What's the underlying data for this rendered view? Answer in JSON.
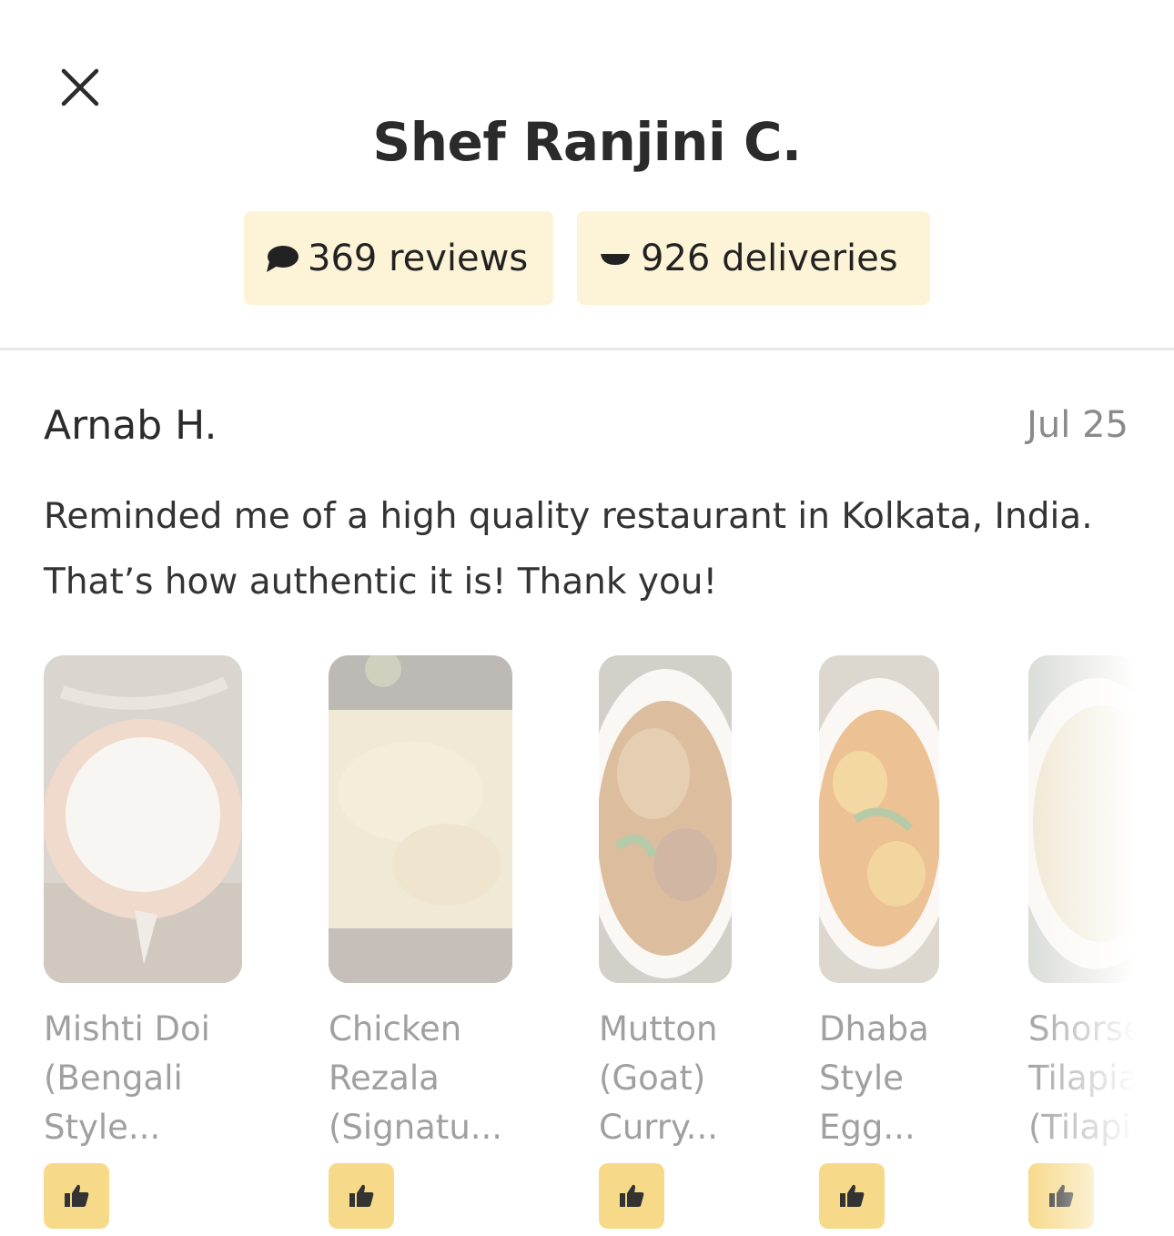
{
  "header": {
    "close_icon": "close-icon",
    "title": "Shef Ranjini C."
  },
  "stats": {
    "reviews": {
      "icon": "chat-bubble-icon",
      "label": "369 reviews"
    },
    "deliveries": {
      "icon": "bowl-icon",
      "label": "926 deliveries"
    }
  },
  "review": {
    "author": "Arnab H.",
    "date": "Jul 25",
    "text": "Reminded me of a high quality restaurant in Kolkata, India. That’s how authentic it is! Thank you!"
  },
  "dishes": [
    {
      "name": "Mishti Doi\n(Bengali\nStyle...",
      "like_icon": "thumbs-up-icon"
    },
    {
      "name": "Chicken\nRezala\n(Signatu...",
      "like_icon": "thumbs-up-icon"
    },
    {
      "name": "Mutton\n(Goat)\nCurry...",
      "like_icon": "thumbs-up-icon"
    },
    {
      "name": "Dhaba\nStyle\nEgg...",
      "like_icon": "thumbs-up-icon"
    },
    {
      "name": "Shorse\nTilapia\n(Tilapia",
      "like_icon": "thumbs-up-icon"
    }
  ],
  "colors": {
    "pill_bg": "#fdf3d6",
    "like_bg": "#f7d98a"
  }
}
